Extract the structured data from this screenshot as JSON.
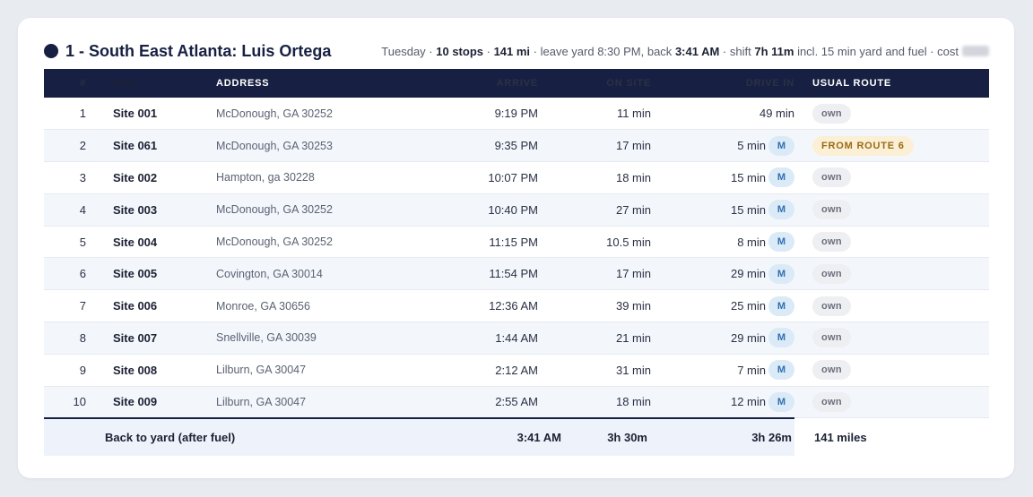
{
  "route": {
    "title": "1 - South East Atlanta: Luis Ortega",
    "meta": {
      "day": "Tuesday",
      "stops": "10 stops",
      "miles": "141 mi",
      "leave_text": "leave yard 8:30 PM, back",
      "back_time": "3:41 AM",
      "shift_label": "shift",
      "shift_value": "7h 11m",
      "shift_note": "incl. 15 min yard and fuel",
      "cost_label": "cost"
    }
  },
  "table": {
    "columns": [
      "#",
      "SITE",
      "ADDRESS",
      "ARRIVE",
      "ON SITE",
      "DRIVE IN",
      "USUAL ROUTE"
    ],
    "rows": [
      {
        "n": "1",
        "site": "Site 001",
        "address": "McDonough, GA 30252",
        "arrive": "9:19 PM",
        "on_site": "11 min",
        "drive": "49 min",
        "mode": "",
        "route": "own"
      },
      {
        "n": "2",
        "site": "Site 061",
        "address": "McDonough, GA 30253",
        "arrive": "9:35 PM",
        "on_site": "17 min",
        "drive": "5 min",
        "mode": "M",
        "route": "FROM ROUTE 6"
      },
      {
        "n": "3",
        "site": "Site 002",
        "address": "Hampton, ga 30228",
        "arrive": "10:07 PM",
        "on_site": "18 min",
        "drive": "15 min",
        "mode": "M",
        "route": "own"
      },
      {
        "n": "4",
        "site": "Site 003",
        "address": "McDonough, GA 30252",
        "arrive": "10:40 PM",
        "on_site": "27 min",
        "drive": "15 min",
        "mode": "M",
        "route": "own"
      },
      {
        "n": "5",
        "site": "Site 004",
        "address": "McDonough, GA 30252",
        "arrive": "11:15 PM",
        "on_site": "10.5 min",
        "drive": "8 min",
        "mode": "M",
        "route": "own"
      },
      {
        "n": "6",
        "site": "Site 005",
        "address": "Covington, GA 30014",
        "arrive": "11:54 PM",
        "on_site": "17 min",
        "drive": "29 min",
        "mode": "M",
        "route": "own"
      },
      {
        "n": "7",
        "site": "Site 006",
        "address": "Monroe, GA 30656",
        "arrive": "12:36 AM",
        "on_site": "39 min",
        "drive": "25 min",
        "mode": "M",
        "route": "own"
      },
      {
        "n": "8",
        "site": "Site 007",
        "address": "Snellville, GA 30039",
        "arrive": "1:44 AM",
        "on_site": "21 min",
        "drive": "29 min",
        "mode": "M",
        "route": "own"
      },
      {
        "n": "9",
        "site": "Site 008",
        "address": "Lilburn, GA 30047",
        "arrive": "2:12 AM",
        "on_site": "31 min",
        "drive": "7 min",
        "mode": "M",
        "route": "own"
      },
      {
        "n": "10",
        "site": "Site 009",
        "address": "Lilburn, GA 30047",
        "arrive": "2:55 AM",
        "on_site": "18 min",
        "drive": "12 min",
        "mode": "M",
        "route": "own"
      }
    ],
    "footer": {
      "label": "Back to yard (after fuel)",
      "arrive": "3:41 AM",
      "on_site": "3h 30m",
      "drive": "3h 26m",
      "distance": "141 miles"
    }
  }
}
